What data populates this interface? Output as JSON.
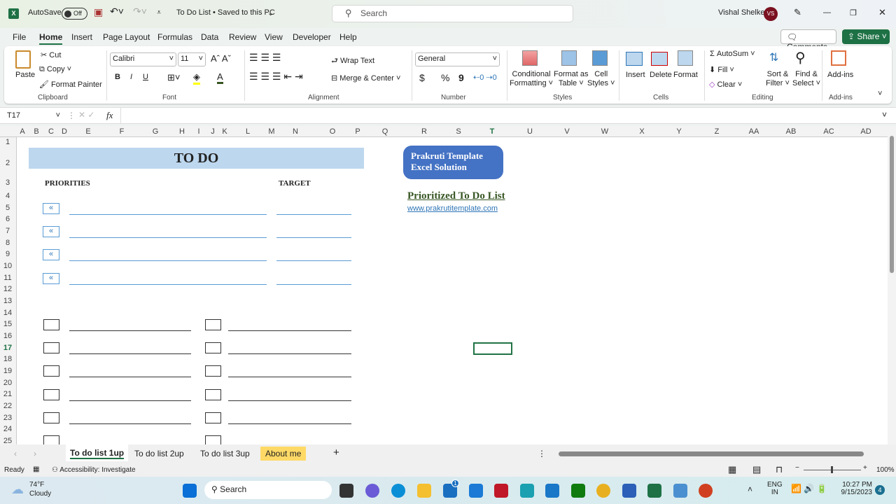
{
  "titlebar": {
    "autosave": "AutoSave",
    "autosave_state": "Off",
    "doc_title": "To Do List • Saved to this PC",
    "search_placeholder": "Search",
    "user": "Vishal Shelke",
    "avatar": "VS"
  },
  "menu": [
    "File",
    "Home",
    "Insert",
    "Page Layout",
    "Formulas",
    "Data",
    "Review",
    "View",
    "Developer",
    "Help"
  ],
  "menu_active": "Home",
  "actions": {
    "comments": "Comments",
    "share": "Share"
  },
  "ribbon": {
    "clipboard": {
      "paste": "Paste",
      "cut": "Cut",
      "copy": "Copy",
      "format_painter": "Format Painter",
      "label": "Clipboard"
    },
    "font": {
      "name": "Calibri",
      "size": "11",
      "bold": "B",
      "italic": "I",
      "underline": "U",
      "label": "Font"
    },
    "alignment": {
      "wrap": "Wrap Text",
      "merge": "Merge & Center",
      "label": "Alignment"
    },
    "number": {
      "format": "General",
      "currency": "$",
      "percent": "%",
      "comma": "9",
      "label": "Number"
    },
    "styles": {
      "conditional": "Conditional",
      "conditional2": "Formatting",
      "format_table": "Format as",
      "format_table2": "Table",
      "cell_styles": "Cell",
      "cell_styles2": "Styles",
      "label": "Styles"
    },
    "cells": {
      "insert": "Insert",
      "delete": "Delete",
      "format": "Format",
      "label": "Cells"
    },
    "editing": {
      "autosum": "AutoSum",
      "fill": "Fill",
      "clear": "Clear",
      "sort": "Sort &",
      "sort2": "Filter",
      "find": "Find &",
      "find2": "Select",
      "label": "Editing"
    },
    "addins": {
      "addins": "Add-ins",
      "label": "Add-ins"
    }
  },
  "formula_bar": {
    "name_box": "T17",
    "fx": "fx",
    "value": ""
  },
  "columns": [
    "A",
    "B",
    "C",
    "D",
    "E",
    "F",
    "G",
    "H",
    "I",
    "J",
    "K",
    "L",
    "M",
    "N",
    "O",
    "P",
    "Q",
    "R",
    "S",
    "T",
    "U",
    "V",
    "W",
    "X",
    "Y",
    "Z",
    "AA",
    "AB",
    "AC",
    "AD"
  ],
  "rows": [
    "1",
    "2",
    "3",
    "4",
    "5",
    "6",
    "7",
    "8",
    "9",
    "10",
    "11",
    "12",
    "13",
    "14",
    "15",
    "16",
    "17",
    "18",
    "19",
    "20",
    "21",
    "22",
    "23",
    "24",
    "25"
  ],
  "sheet": {
    "title": "TO DO",
    "priorities": "PRIORITIES",
    "target": "TARGET",
    "arrow": "«",
    "badge_line1": "Prakruti Template",
    "badge_line2": "Excel Solution",
    "heading": "Prioritized To Do List",
    "link": "www.prakrutitemplate.com"
  },
  "selected_cell": "T17",
  "sheet_tabs": [
    {
      "label": "To do list 1up",
      "active": true
    },
    {
      "label": "To do list 2up"
    },
    {
      "label": "To do list 3up"
    },
    {
      "label": "About me",
      "color": "#ffd966"
    }
  ],
  "status": {
    "ready": "Ready",
    "accessibility": "Accessibility: Investigate",
    "zoom": "100%"
  },
  "taskbar": {
    "temp": "74°F",
    "weather": "Cloudy",
    "search": "Search",
    "lang1": "ENG",
    "lang2": "IN",
    "time": "10:27 PM",
    "date": "9/15/2023",
    "notif": "4",
    "store_badge": "1"
  },
  "colors": {
    "excel_green": "#217346",
    "share_green": "#1e7145",
    "band_blue": "#bdd7ee",
    "badge_blue": "#4472c4",
    "about_tab": "#ffd966"
  }
}
